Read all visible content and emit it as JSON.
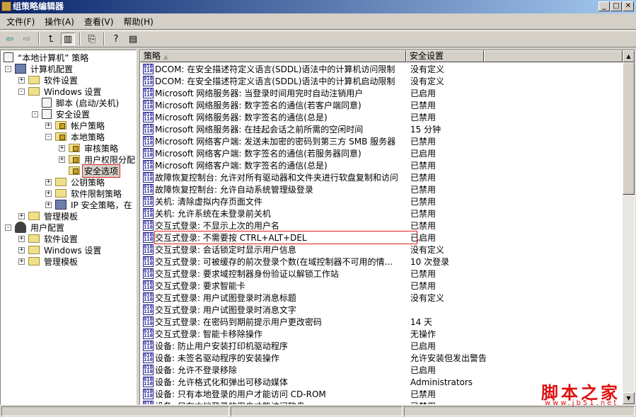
{
  "window": {
    "title": "组策略编辑器",
    "controls": [
      "_",
      "□",
      "✕"
    ]
  },
  "menu": [
    "文件(F)",
    "操作(A)",
    "查看(V)",
    "帮助(H)"
  ],
  "toolbar": [
    {
      "icon": "back-arrow-icon",
      "glyph": "⇦"
    },
    {
      "icon": "forward-arrow-icon",
      "glyph": "⇨"
    },
    {
      "sep": true
    },
    {
      "icon": "up-folder-icon",
      "glyph": "⮤"
    },
    {
      "icon": "show-tree-icon",
      "glyph": "▥",
      "pressed": true
    },
    {
      "sep": true
    },
    {
      "icon": "export-list-icon",
      "glyph": "⎘"
    },
    {
      "sep": true
    },
    {
      "icon": "help-icon",
      "glyph": "?"
    },
    {
      "icon": "action-pane-icon",
      "glyph": "▤"
    }
  ],
  "tree": [
    {
      "level": 0,
      "exp": "",
      "icon": "script",
      "label": "“本地计算机” 策略"
    },
    {
      "level": 1,
      "exp": "-",
      "icon": "computer",
      "label": "计算机配置"
    },
    {
      "level": 2,
      "exp": "+",
      "icon": "folder",
      "label": "软件设置"
    },
    {
      "level": 2,
      "exp": "-",
      "icon": "folder",
      "label": "Windows 设置"
    },
    {
      "level": 3,
      "exp": "",
      "icon": "script",
      "label": "脚本 (启动/关机)"
    },
    {
      "level": 3,
      "exp": "-",
      "icon": "security",
      "label": "安全设置"
    },
    {
      "level": 4,
      "exp": "+",
      "icon": "lockfolder",
      "label": "帐户策略"
    },
    {
      "level": 4,
      "exp": "-",
      "icon": "lockfolder",
      "label": "本地策略"
    },
    {
      "level": 5,
      "exp": "+",
      "icon": "lockfolder",
      "label": "审核策略"
    },
    {
      "level": 5,
      "exp": "+",
      "icon": "lockfolder",
      "label": "用户权限分配"
    },
    {
      "level": 5,
      "exp": "",
      "icon": "lockfolder",
      "label": "安全选项",
      "selected": true
    },
    {
      "level": 4,
      "exp": "+",
      "icon": "folder",
      "label": "公钥策略"
    },
    {
      "level": 4,
      "exp": "+",
      "icon": "folder",
      "label": "软件限制策略"
    },
    {
      "level": 4,
      "exp": "+",
      "icon": "computer",
      "label": "IP 安全策略，在"
    },
    {
      "level": 2,
      "exp": "+",
      "icon": "folder",
      "label": "管理模板"
    },
    {
      "level": 1,
      "exp": "-",
      "icon": "user",
      "label": "用户配置"
    },
    {
      "level": 2,
      "exp": "+",
      "icon": "folder",
      "label": "软件设置"
    },
    {
      "level": 2,
      "exp": "+",
      "icon": "folder",
      "label": "Windows 设置"
    },
    {
      "level": 2,
      "exp": "+",
      "icon": "folder",
      "label": "管理模板"
    }
  ],
  "list": {
    "columns": [
      "策略",
      "安全设置"
    ],
    "sort_indicator": "▲",
    "rows": [
      [
        "DCOM: 在安全描述符定义语言(SDDL)语法中的计算机访问限制",
        "没有定义"
      ],
      [
        "DCOM: 在安全描述符定义语言(SDDL)语法中的计算机启动限制",
        "没有定义"
      ],
      [
        "Microsoft 网络服务器: 当登录时间用完时自动注销用户",
        "已启用"
      ],
      [
        "Microsoft 网络服务器: 数字签名的通信(若客户端同意)",
        "已禁用"
      ],
      [
        "Microsoft 网络服务器: 数字签名的通信(总是)",
        "已禁用"
      ],
      [
        "Microsoft 网络服务器: 在挂起会话之前所需的空闲时间",
        "15 分钟"
      ],
      [
        "Microsoft 网络客户端: 发送未加密的密码到第三方 SMB 服务器",
        "已禁用"
      ],
      [
        "Microsoft 网络客户端: 数字签名的通信(若服务器同意)",
        "已启用"
      ],
      [
        "Microsoft 网络客户端: 数字签名的通信(总是)",
        "已禁用"
      ],
      [
        "故障恢复控制台: 允许对所有驱动器和文件夹进行软盘复制和访问",
        "已禁用"
      ],
      [
        "故障恢复控制台: 允许自动系统管理级登录",
        "已禁用"
      ],
      [
        "关机: 清除虚拟内存页面文件",
        "已禁用"
      ],
      [
        "关机: 允许系统在未登录前关机",
        "已禁用"
      ],
      [
        "交互式登录: 不显示上次的用户名",
        "已禁用"
      ],
      [
        "交互式登录: 不需要按 CTRL+ALT+DEL",
        "已启用"
      ],
      [
        "交互式登录: 会话锁定时显示用户信息",
        "没有定义"
      ],
      [
        "交互式登录: 可被缓存的前次登录个数(在域控制器不可用的情...",
        "10 次登录"
      ],
      [
        "交互式登录: 要求域控制器身份验证以解锁工作站",
        "已禁用"
      ],
      [
        "交互式登录: 要求智能卡",
        "已禁用"
      ],
      [
        "交互式登录: 用户试图登录时消息标题",
        "没有定义"
      ],
      [
        "交互式登录: 用户试图登录时消息文字",
        ""
      ],
      [
        "交互式登录: 在密码到期前提示用户更改密码",
        "14 天"
      ],
      [
        "交互式登录: 智能卡移除操作",
        "无操作"
      ],
      [
        "设备: 防止用户安装打印机驱动程序",
        "已启用"
      ],
      [
        "设备: 未签名驱动程序的安装操作",
        "允许安装但发出警告"
      ],
      [
        "设备: 允许不登录移除",
        "已启用"
      ],
      [
        "设备: 允许格式化和弹出可移动媒体",
        "Administrators"
      ],
      [
        "设备: 只有本地登录的用户才能访问 CD-ROM",
        "已禁用"
      ],
      [
        "设备: 只有本地登录的用户才能访问软盘",
        "已禁用"
      ]
    ],
    "highlighted_row": 14
  },
  "watermark": {
    "text": "脚本之家",
    "url": "www.jb51.net"
  },
  "colors": {
    "highlight": "#e02020",
    "title_start": "#0a246a",
    "title_end": "#a6caf0"
  }
}
